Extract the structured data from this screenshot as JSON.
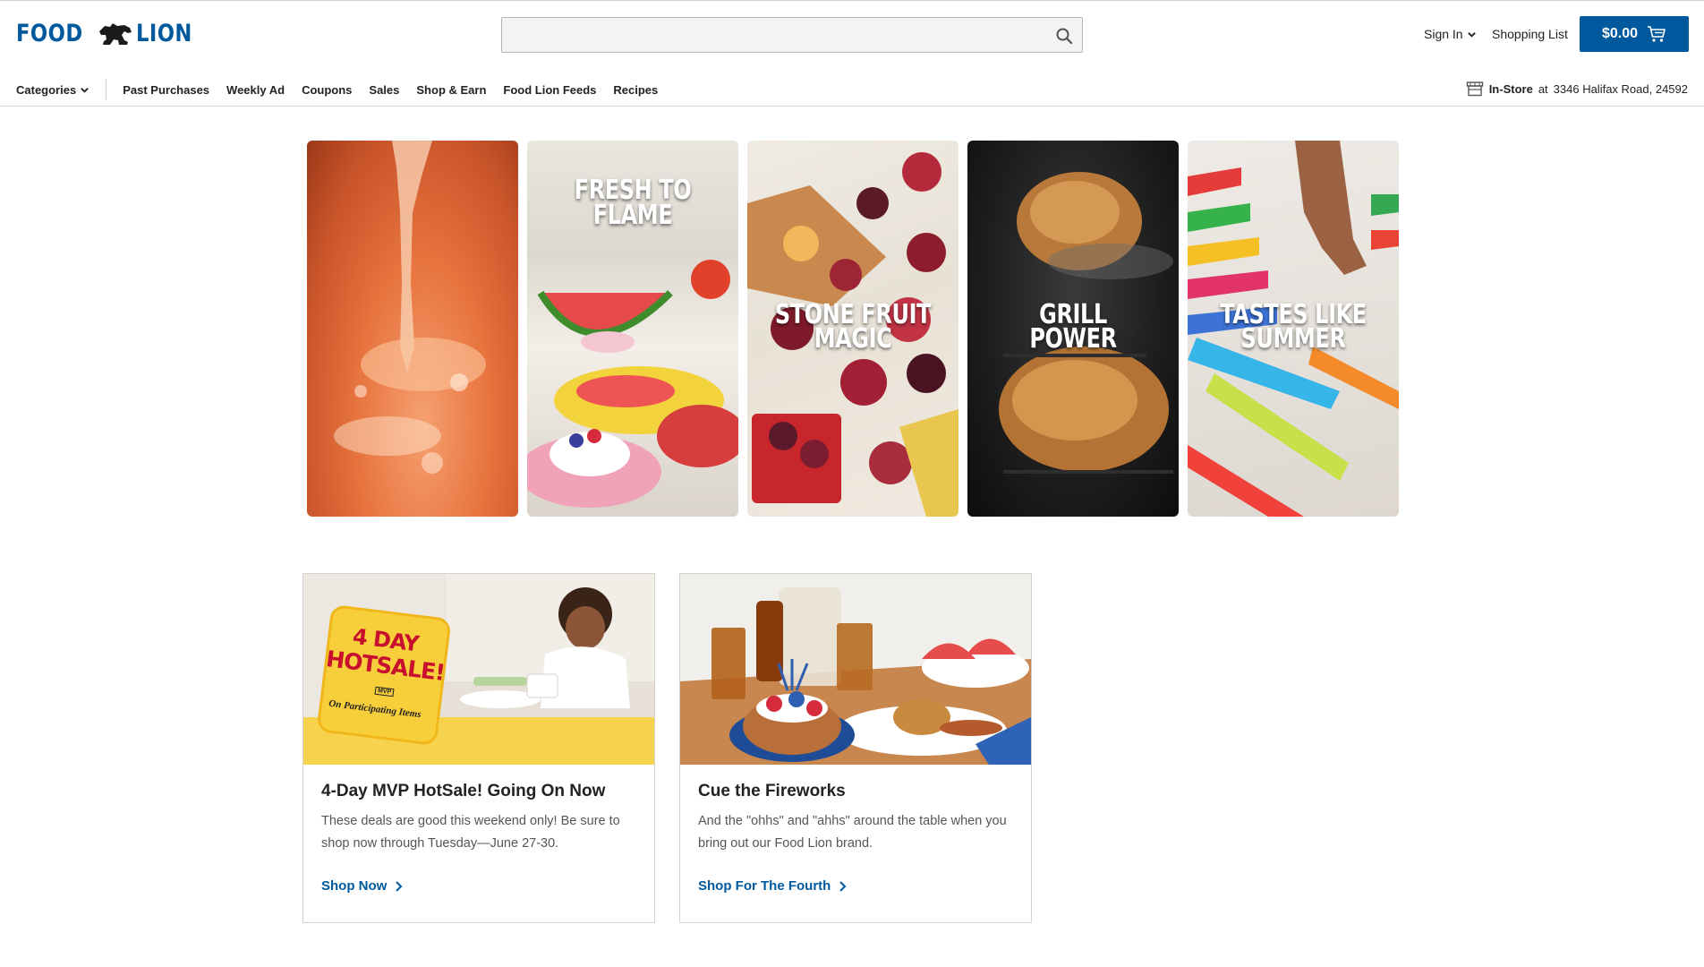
{
  "header": {
    "logo_left": "FOOD",
    "logo_right": "LION",
    "search": {
      "placeholder": "",
      "value": ""
    },
    "sign_in_label": "Sign In",
    "shopping_list_label": "Shopping List",
    "cart_total": "$0.00"
  },
  "nav": {
    "categories_label": "Categories",
    "items": [
      "Past Purchases",
      "Weekly Ad",
      "Coupons",
      "Sales",
      "Shop & Earn",
      "Food Lion Feeds",
      "Recipes"
    ]
  },
  "store": {
    "mode": "In-Store",
    "at": "at",
    "address": "3346 Halifax Road, 24592"
  },
  "tiles": [
    {
      "label": ""
    },
    {
      "label": "FRESH TO\nFLAME"
    },
    {
      "label": "STONE FRUIT\nMAGIC"
    },
    {
      "label": "GRILL\nPOWER"
    },
    {
      "label": "TASTES LIKE\nSUMMER"
    }
  ],
  "cards": [
    {
      "title": "4-Day MVP HotSale! Going On Now",
      "description": "These deals are good this weekend only! Be sure to shop now through Tuesday—June 27-30.",
      "link": "Shop Now",
      "badge": {
        "line1": "4 DAY",
        "line2": "HOTSALE!",
        "mvp": "MVP",
        "line3": "On Participating Items"
      }
    },
    {
      "title": "Cue the Fireworks",
      "description": "And the \"ohhs\" and \"ahhs\" around the table when you bring out our Food Lion brand.",
      "link": "Shop For The Fourth"
    }
  ],
  "colors": {
    "brand_blue": "#00599c",
    "badge_yellow": "#f7cf3a",
    "badge_red": "#c8102e"
  }
}
